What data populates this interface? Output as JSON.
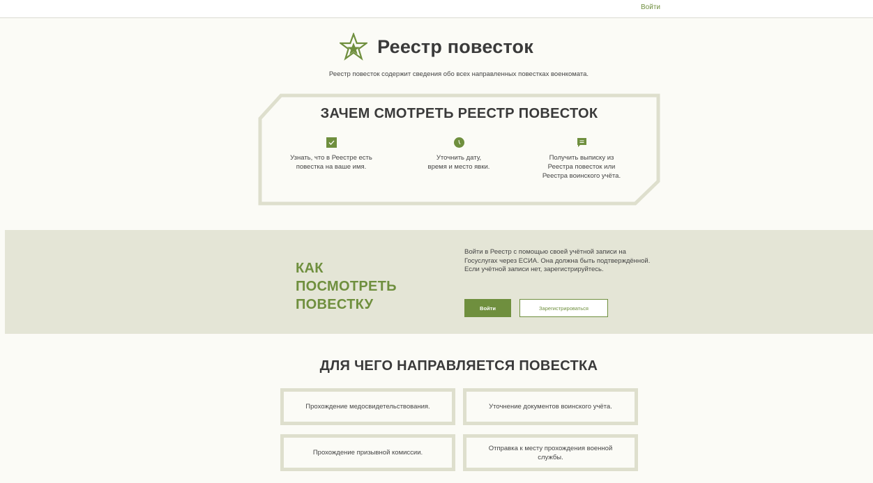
{
  "header": {
    "login_link": "Войти"
  },
  "hero": {
    "title": "Реестр повесток",
    "subtitle": "Реестр повесток содержит сведения обо всех направленных повестках военкомата."
  },
  "why": {
    "title": "ЗАЧЕМ СМОТРЕТЬ РЕЕСТР ПОВЕСТОК",
    "items": [
      {
        "icon": "checkbox-icon",
        "text_line1": "Узнать, что в Реестре есть",
        "text_line2": "повестка на ваше имя.",
        "text_line3": ""
      },
      {
        "icon": "clock-icon",
        "text_line1": "Уточнить дату,",
        "text_line2": "время и место явки.",
        "text_line3": ""
      },
      {
        "icon": "message-icon",
        "text_line1": "Получить выписку из",
        "text_line2": "Реестра повесток или",
        "text_line3": "Реестра воинского учёта."
      }
    ]
  },
  "how": {
    "title_line1": "КАК",
    "title_line2": "ПОСМОТРЕТЬ",
    "title_line3": "ПОВЕСТКУ",
    "text": "Войти в Реестр с помощью своей учётной записи на Госуслугах через ЕСИА. Она должна быть подтверждённой. Если учётной записи нет, зарегистрируйтесь.",
    "login_button": "Войти",
    "register_button": "Зарегистрироваться"
  },
  "purpose": {
    "title": "ДЛЯ ЧЕГО НАПРАВЛЯЕТСЯ ПОВЕСТКА",
    "cards": [
      "Прохождение медосвидетельствования.",
      "Уточнение документов воинского учёта.",
      "Прохождение призывной комиссии.",
      "Отправка к месту прохождения военной службы."
    ]
  },
  "colors": {
    "accent": "#6f8f3e",
    "band": "#e4e5d6",
    "frame": "#dedfcd",
    "background": "#fbfbf6"
  }
}
